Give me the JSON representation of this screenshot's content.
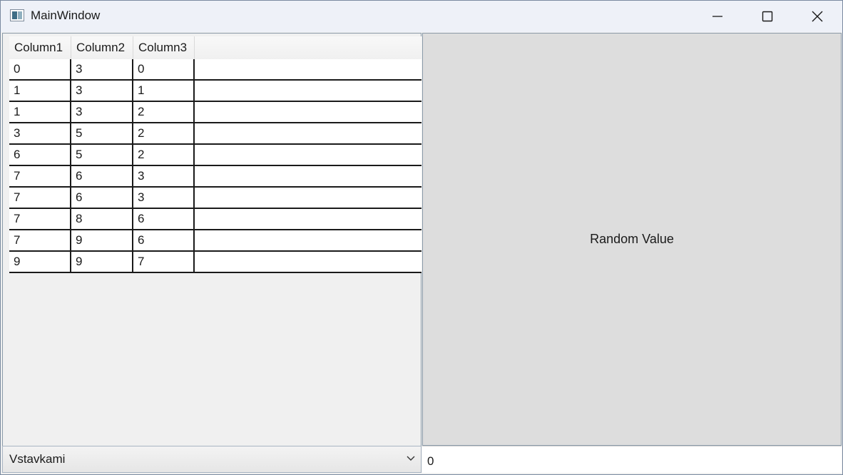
{
  "window": {
    "title": "MainWindow",
    "icon": "app-window-icon",
    "controls": [
      "minimize-icon",
      "maximize-icon",
      "close-icon"
    ]
  },
  "grid": {
    "columns": [
      "Column1",
      "Column2",
      "Column3"
    ],
    "rows": [
      [
        "0",
        "3",
        "0"
      ],
      [
        "1",
        "3",
        "1"
      ],
      [
        "1",
        "3",
        "2"
      ],
      [
        "3",
        "5",
        "2"
      ],
      [
        "6",
        "5",
        "2"
      ],
      [
        "7",
        "6",
        "3"
      ],
      [
        "7",
        "6",
        "3"
      ],
      [
        "7",
        "8",
        "6"
      ],
      [
        "7",
        "9",
        "6"
      ],
      [
        "9",
        "9",
        "7"
      ]
    ]
  },
  "random_panel": {
    "label": "Random Value"
  },
  "sort_combo": {
    "selected": "Vstavkami",
    "icon": "chevron-down-icon"
  },
  "value_field": {
    "value": "0"
  }
}
